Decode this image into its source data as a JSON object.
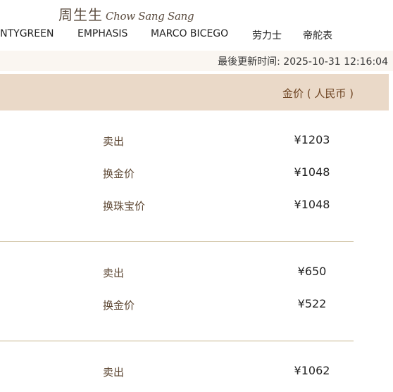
{
  "brand": {
    "logo_cn": "周生生",
    "logo_en": "Chow Sang Sang"
  },
  "nav": [
    "INTYGREEN",
    "EMPHASIS",
    "MARCO BICEGO",
    "劳力士",
    "帝舵表"
  ],
  "update_notice": "最後更新时间: 2025-10-31 12:16:04",
  "table": {
    "header": "金价 ( 人民币 )",
    "groups": [
      {
        "rows": [
          {
            "label": "卖出",
            "price": "¥1203"
          },
          {
            "label": "换金价",
            "price": "¥1048"
          },
          {
            "label": "换珠宝价",
            "price": "¥1048"
          }
        ]
      },
      {
        "rows": [
          {
            "label": "卖出",
            "price": "¥650"
          },
          {
            "label": "换金价",
            "price": "¥522"
          }
        ]
      },
      {
        "rows": [
          {
            "label": "卖出",
            "price": "¥1062"
          }
        ]
      }
    ]
  }
}
